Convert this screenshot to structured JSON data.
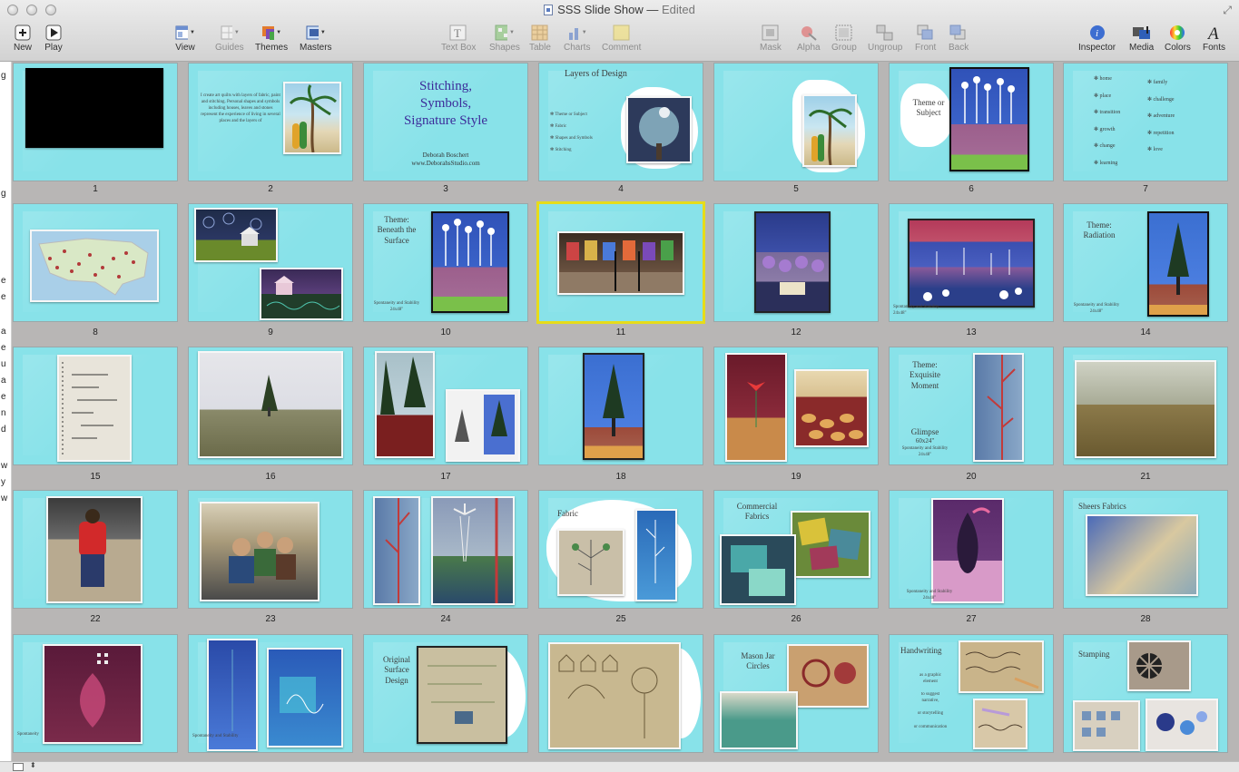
{
  "window": {
    "title": "SSS Slide Show",
    "separator": "—",
    "status": "Edited"
  },
  "toolbar": {
    "new": "New",
    "play": "Play",
    "view": "View",
    "guides": "Guides",
    "themes": "Themes",
    "masters": "Masters",
    "text_box": "Text Box",
    "shapes": "Shapes",
    "table": "Table",
    "charts": "Charts",
    "comment": "Comment",
    "mask": "Mask",
    "alpha": "Alpha",
    "group": "Group",
    "ungroup": "Ungroup",
    "front": "Front",
    "back": "Back",
    "inspector": "Inspector",
    "media": "Media",
    "colors": "Colors",
    "fonts": "Fonts"
  },
  "selected_slide": 11,
  "slide_numbers": [
    "1",
    "2",
    "3",
    "4",
    "5",
    "6",
    "7",
    "8",
    "9",
    "10",
    "11",
    "12",
    "13",
    "14",
    "15",
    "16",
    "17",
    "18",
    "19",
    "20",
    "21",
    "22",
    "23",
    "24",
    "25",
    "26",
    "27",
    "28"
  ],
  "slides": {
    "s2": {
      "body": "I create art quilts with layers of fabric, paint and stitching. Personal shapes and symbols including houses, leaves and stones represent the experience of living in several places and the layers of"
    },
    "s3": {
      "title_1": "Stitching,",
      "title_2": "Symbols,",
      "title_3": "Signature Style",
      "author": "Deborah Boschert",
      "site": "www.DeborahsStudio.com"
    },
    "s4": {
      "title": "Layers of Design",
      "items": [
        "Theme or Subject",
        "Fabric",
        "Shapes and Symbols",
        "Stitching"
      ]
    },
    "s6": {
      "label_1": "Theme or",
      "label_2": "Subject"
    },
    "s7": {
      "col1": [
        "home",
        "place",
        "transition",
        "growth",
        "change",
        "learning"
      ],
      "col2": [
        "family",
        "challenge",
        "adventure",
        "repetition",
        "love"
      ]
    },
    "s10": {
      "label_1": "Theme:",
      "label_2": "Beneath the",
      "label_3": "Surface",
      "caption_1": "Spontaneity and Stability",
      "caption_2": "24x48\""
    },
    "s13": {
      "caption": "Spontaneity and Stability 24x48\""
    },
    "s14": {
      "label_1": "Theme:",
      "label_2": "Radiation",
      "caption_1": "Spontaneity and Stability",
      "caption_2": "24x48\""
    },
    "s20": {
      "label_1": "Theme:",
      "label_2": "Exquisite",
      "label_3": "Moment",
      "glimpse": "Glimpse",
      "size": "60x24\"",
      "caption_1": "Spontaneity and Stability",
      "caption_2": "24x48\""
    },
    "s25": {
      "label": "Fabric"
    },
    "s26": {
      "label_1": "Commercial",
      "label_2": "Fabrics"
    },
    "s27": {
      "caption_1": "Spontaneity and Stability",
      "caption_2": "24x48\""
    },
    "s28": {
      "label": "Sheers Fabrics"
    },
    "s29": {
      "caption": "Spontaneity"
    },
    "s30": {
      "caption": "Spontaneity and Stability"
    },
    "s31": {
      "label_1": "Original",
      "label_2": "Surface",
      "label_3": "Design"
    },
    "s33": {
      "label_1": "Mason Jar",
      "label_2": "Circles"
    },
    "s34": {
      "label": "Handwriting",
      "notes": [
        "as a graphic",
        "element",
        "to suggest",
        "narrative,",
        "or storytelling",
        "or communication"
      ]
    },
    "s35": {
      "label": "Stamping"
    }
  },
  "left_strip": [
    "g",
    "g",
    "e",
    "e",
    "a",
    "e",
    "u",
    "a",
    "e",
    "n",
    "d",
    "w",
    "y",
    "w"
  ],
  "colors": {
    "slide_bg": "#88e2e9",
    "browser_bg": "#b8b6b5",
    "selection": "#e6dc1a",
    "title_purple": "#3c2c9a"
  }
}
